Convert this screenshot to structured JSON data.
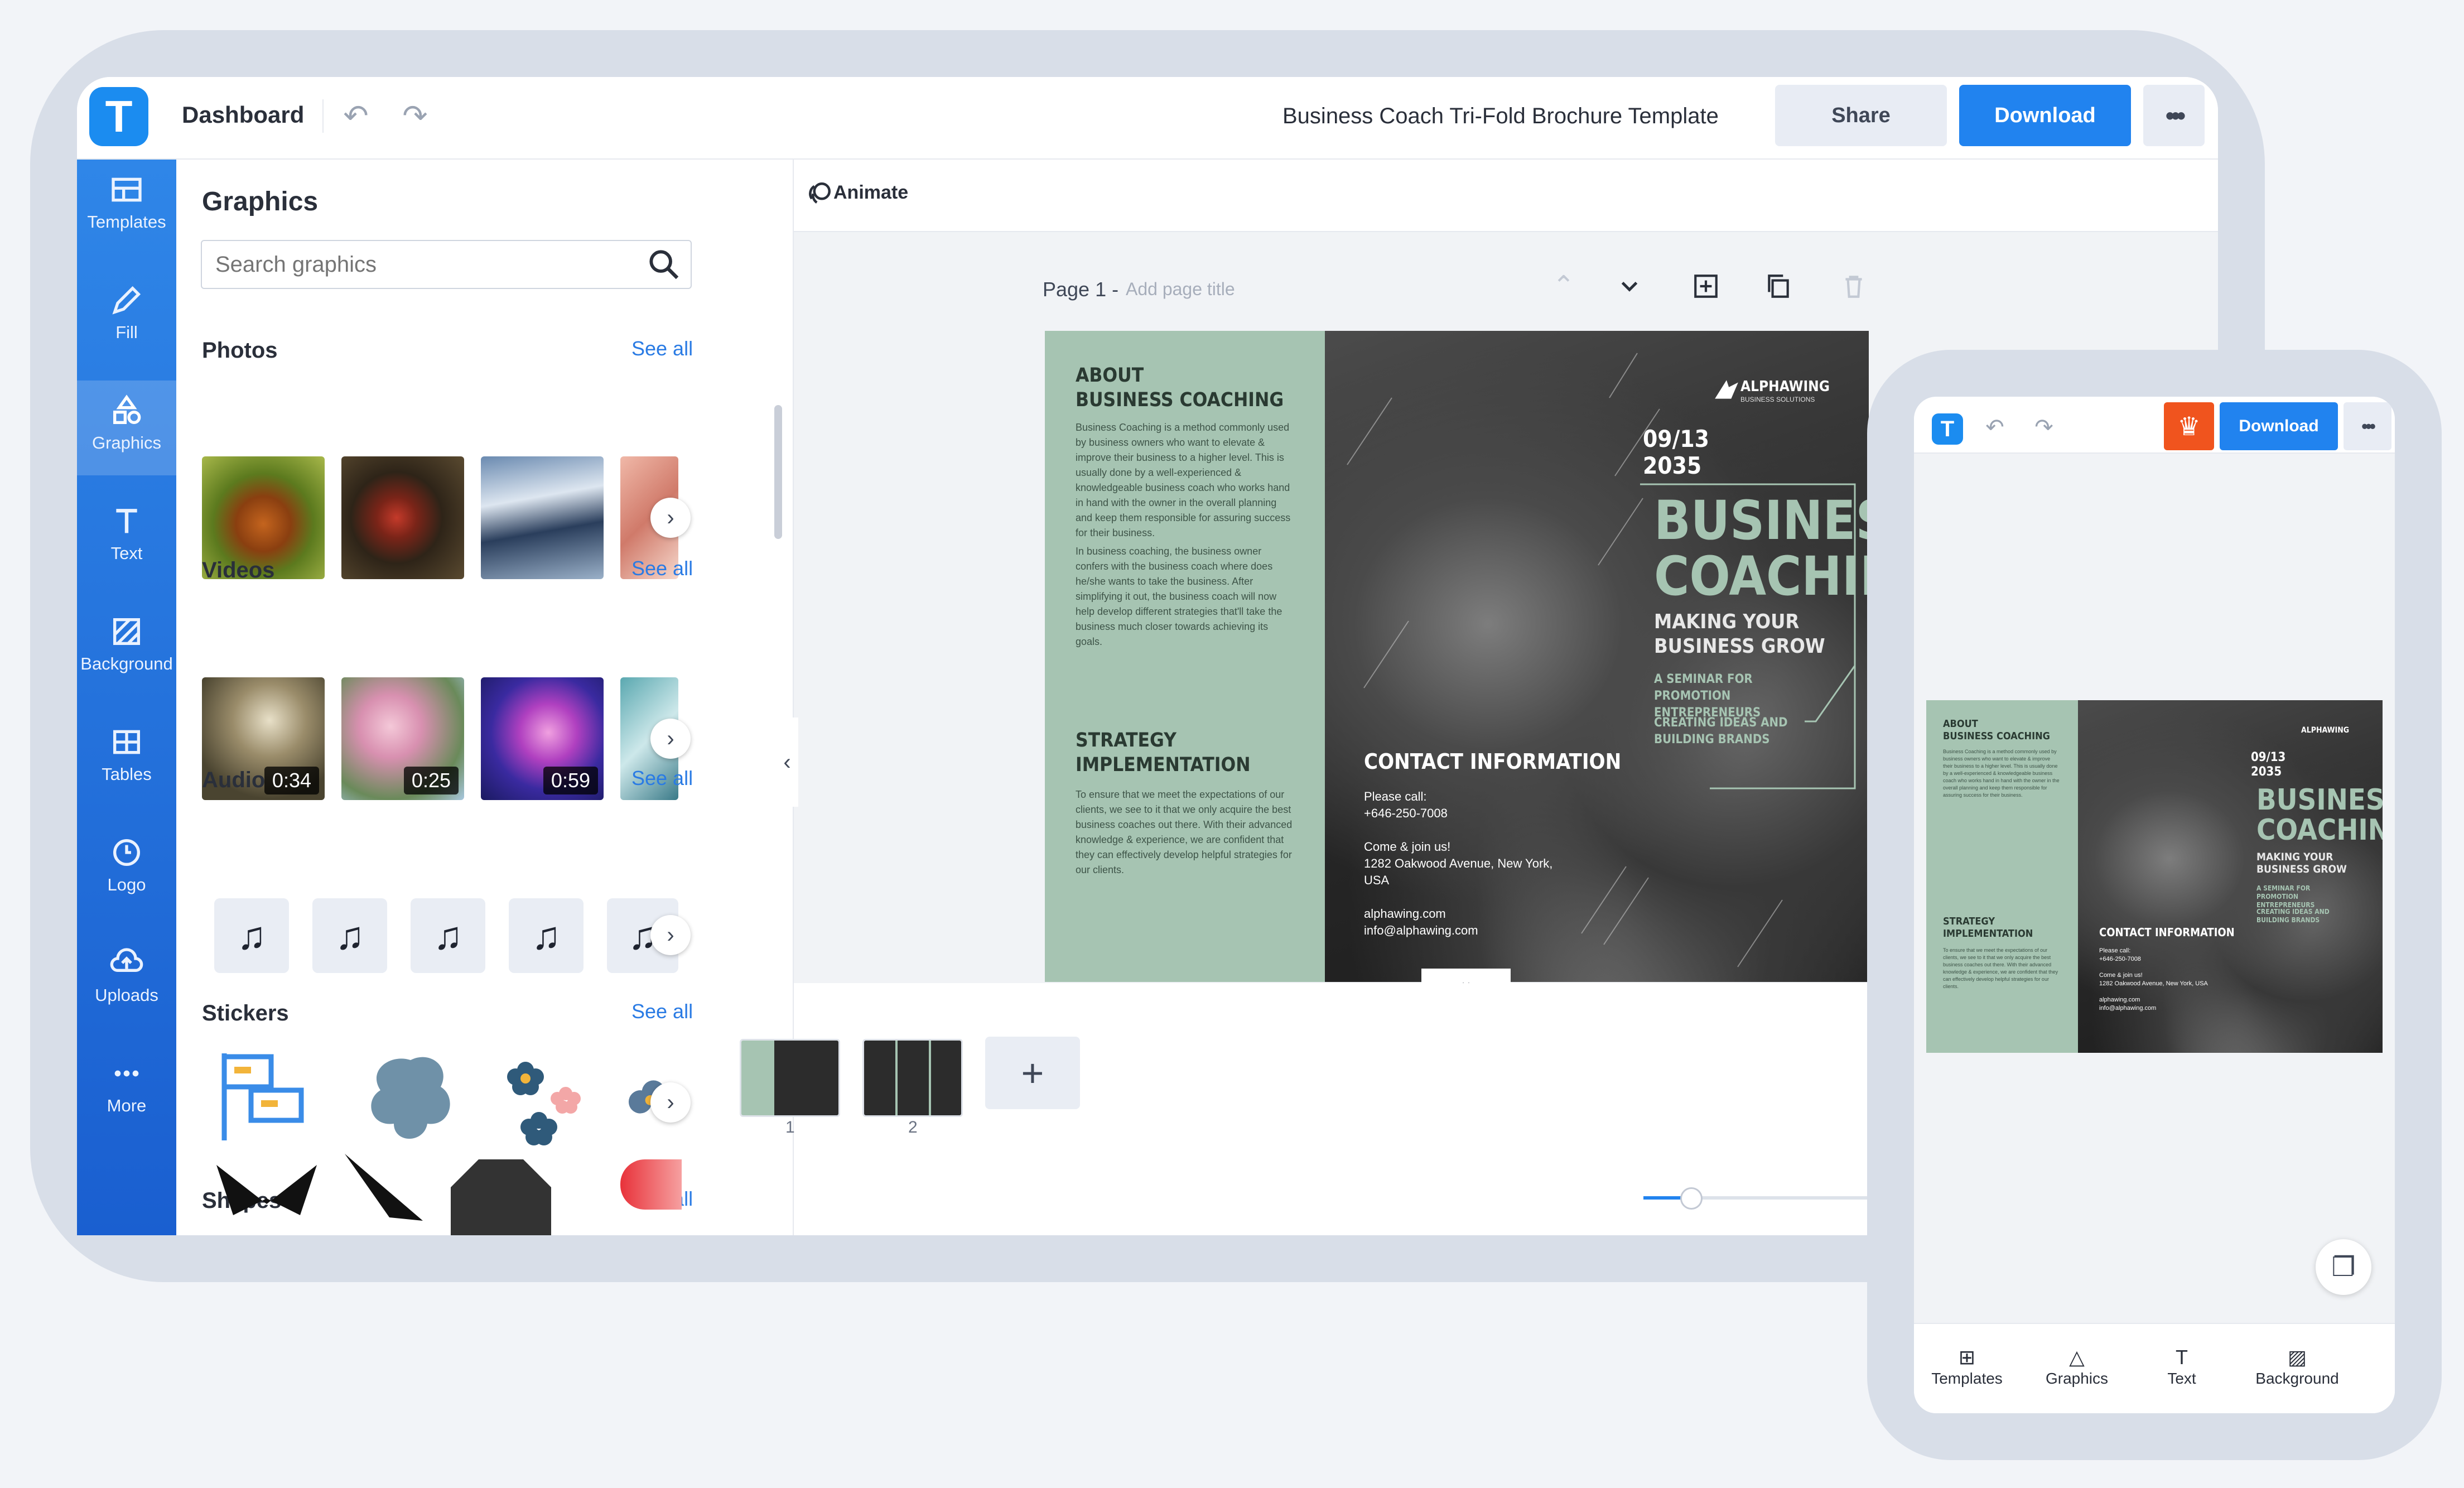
{
  "header": {
    "logo_letter": "T",
    "dashboard": "Dashboard",
    "undo_icon": "↶",
    "redo_icon": "↷",
    "doc_title": "Business Coach Tri-Fold Brochure Template",
    "share": "Share",
    "download": "Download",
    "more": "•••"
  },
  "rail": [
    {
      "label": "Templates",
      "icon": "templates-icon"
    },
    {
      "label": "Fill",
      "icon": "fill-icon"
    },
    {
      "label": "Graphics",
      "icon": "graphics-icon"
    },
    {
      "label": "Text",
      "icon": "text-icon"
    },
    {
      "label": "Background",
      "icon": "background-icon"
    },
    {
      "label": "Tables",
      "icon": "tables-icon"
    },
    {
      "label": "Logo",
      "icon": "logo-icon"
    },
    {
      "label": "Uploads",
      "icon": "uploads-icon"
    },
    {
      "label": "More",
      "icon": "more-icon"
    }
  ],
  "panel": {
    "title": "Graphics",
    "search_placeholder": "Search graphics",
    "sections": {
      "photos": {
        "title": "Photos",
        "see_all": "See all"
      },
      "videos": {
        "title": "Videos",
        "see_all": "See all",
        "durations": [
          "0:34",
          "0:25",
          "0:59"
        ]
      },
      "audio": {
        "title": "Audio",
        "see_all": "See all",
        "icon": "♫"
      },
      "stickers": {
        "title": "Stickers",
        "see_all": "See all"
      },
      "shapes": {
        "title": "Shapes",
        "see_all": "See all"
      }
    }
  },
  "canvas": {
    "animate": "Animate",
    "page_label": "Page 1 -",
    "add_page_title": "Add page title",
    "pages": [
      "1",
      "2"
    ],
    "add_page": "+"
  },
  "brochure": {
    "about_title_1": "ABOUT",
    "about_title_2": "BUSINESS COACHING",
    "about_body_1": "Business Coaching is a method commonly used by business owners who want to elevate & improve their business to a higher level. This is usually done by a well-experienced & knowledgeable business coach who works hand in hand with the owner in the overall planning and keep them responsible for assuring success for their business.",
    "about_body_2": "In business coaching, the business owner confers with the business coach where does he/she wants to take the business. After simplifying it out, the business coach will now help develop different strategies that'll take the business much closer towards achieving its goals.",
    "strategy_title_1": "STRATEGY",
    "strategy_title_2": "IMPLEMENTATION",
    "strategy_body": "To ensure that we meet the expectations of our clients, we see to it that we only acquire the best business coaches out there. With their advanced knowledge & experience, we are confident that they can effectively develop helpful strategies for our clients.",
    "contact_title": "CONTACT INFORMATION",
    "contact_call": "Please call:",
    "contact_phone": "+646-250-7008",
    "contact_join": "Come & join us!",
    "contact_address": "1282 Oakwood Avenue, New York, USA",
    "contact_web": "alphawing.com",
    "contact_email": "info@alphawing.com",
    "brand": "ALPHAWING",
    "brand_sub": "BUSINESS SOLUTIONS",
    "date_1": "09/13",
    "date_2": "2035",
    "headline_1": "BUSINESS",
    "headline_2": "COACHING",
    "tagline": "MAKING YOUR BUSINESS GROW",
    "sub_1": "A SEMINAR FOR PROMOTION ENTREPRENEURS",
    "sub_2": "CREATING IDEAS AND BUILDING BRANDS"
  },
  "phone": {
    "logo_letter": "T",
    "download": "Download",
    "crown_icon": "♛",
    "more": "•••",
    "nav": [
      {
        "label": "Templates",
        "icon": "⊞"
      },
      {
        "label": "Graphics",
        "icon": "△"
      },
      {
        "label": "Text",
        "icon": "T"
      },
      {
        "label": "Background",
        "icon": "▨"
      }
    ],
    "layers_icon": "❐"
  },
  "colors": {
    "brand_blue": "#2183ef",
    "rail_top": "#2f86e8",
    "brochure_green": "#a6c4b2",
    "crown_orange": "#f0541e"
  }
}
